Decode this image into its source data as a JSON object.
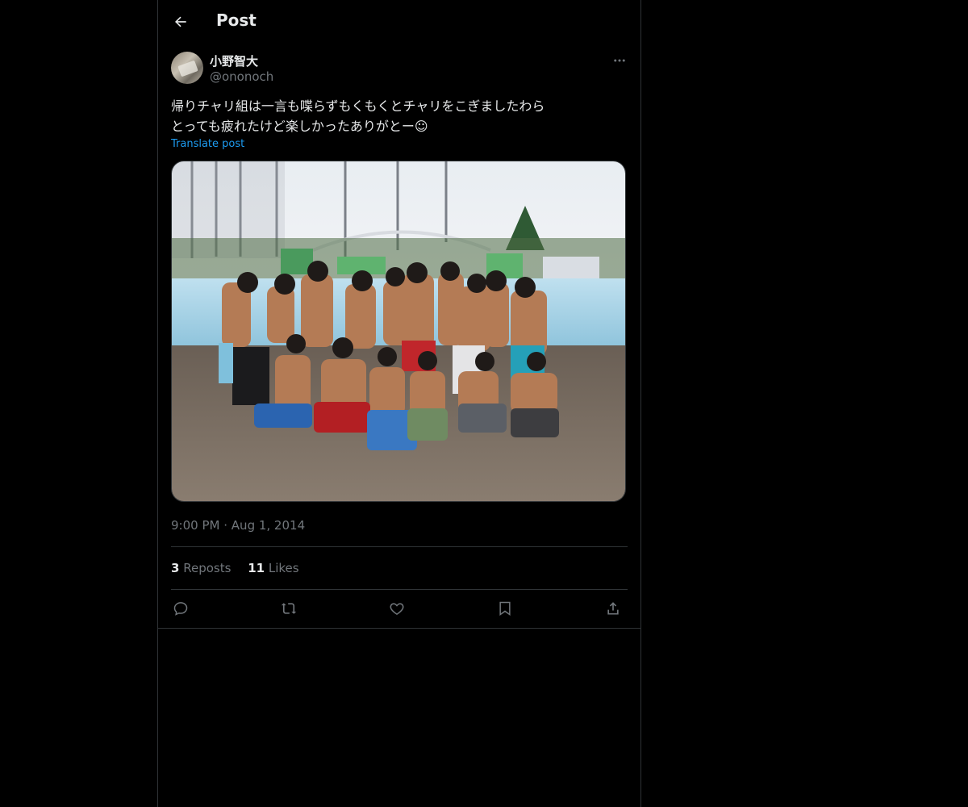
{
  "header": {
    "title": "Post",
    "back_icon": "arrow-left-icon"
  },
  "post": {
    "author_name": "小野智大",
    "author_handle": "@ononoch",
    "more_icon": "more-horizontal-icon",
    "text": "帰りチャリ組は一言も喋らずもくもくとチャリをこぎましたわら\nとっても疲れたけど楽しかったありがとー☺",
    "translate_label": "Translate post",
    "time": "9:00 PM",
    "separator": "·",
    "date": "Aug 1, 2014"
  },
  "stats": {
    "reposts_count": "3",
    "reposts_label": "Reposts",
    "likes_count": "11",
    "likes_label": "Likes"
  },
  "actions": {
    "reply_icon": "reply-icon",
    "repost_icon": "repost-icon",
    "like_icon": "heart-icon",
    "bookmark_icon": "bookmark-icon",
    "share_icon": "share-icon"
  },
  "colors": {
    "accent": "#1d9bf0",
    "muted": "#71767b",
    "text": "#e7e9ea",
    "border": "#2f3336"
  }
}
